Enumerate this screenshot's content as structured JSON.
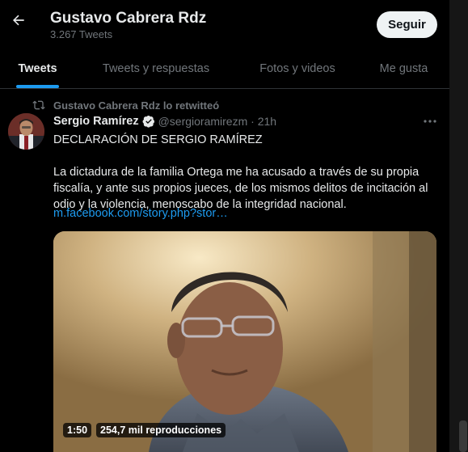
{
  "header": {
    "name": "Gustavo Cabrera Rdz",
    "tweet_count": "3.267 Tweets",
    "follow_label": "Seguir"
  },
  "tabs": [
    {
      "label": "Tweets",
      "active": true
    },
    {
      "label": "Tweets y respuestas",
      "active": false
    },
    {
      "label": "Fotos y videos",
      "active": false
    },
    {
      "label": "Me gusta",
      "active": false
    }
  ],
  "tweet": {
    "retweeted_by": "Gustavo Cabrera Rdz lo retwitteó",
    "author_name": "Sergio Ramírez",
    "author_handle": "@sergioramirezm · 21h",
    "verified": true,
    "text": "DECLARACIÓN DE SERGIO RAMÍREZ\n\nLa dictadura de la familia Ortega me ha acusado a través de su propia fiscalía, y ante sus propios jueces, de los mismos delitos de incitación al odio y la violencia, menoscabo de la integridad nacional.",
    "link": "m.facebook.com/story.php?stor…",
    "video": {
      "duration": "1:50",
      "views": "254,7 mil reproducciones"
    }
  },
  "colors": {
    "background": "#000000",
    "accent": "#1d9bf0",
    "muted": "#71767b"
  },
  "icons": [
    "back-arrow-icon",
    "retweet-icon",
    "verified-badge-icon",
    "more-options-icon"
  ]
}
